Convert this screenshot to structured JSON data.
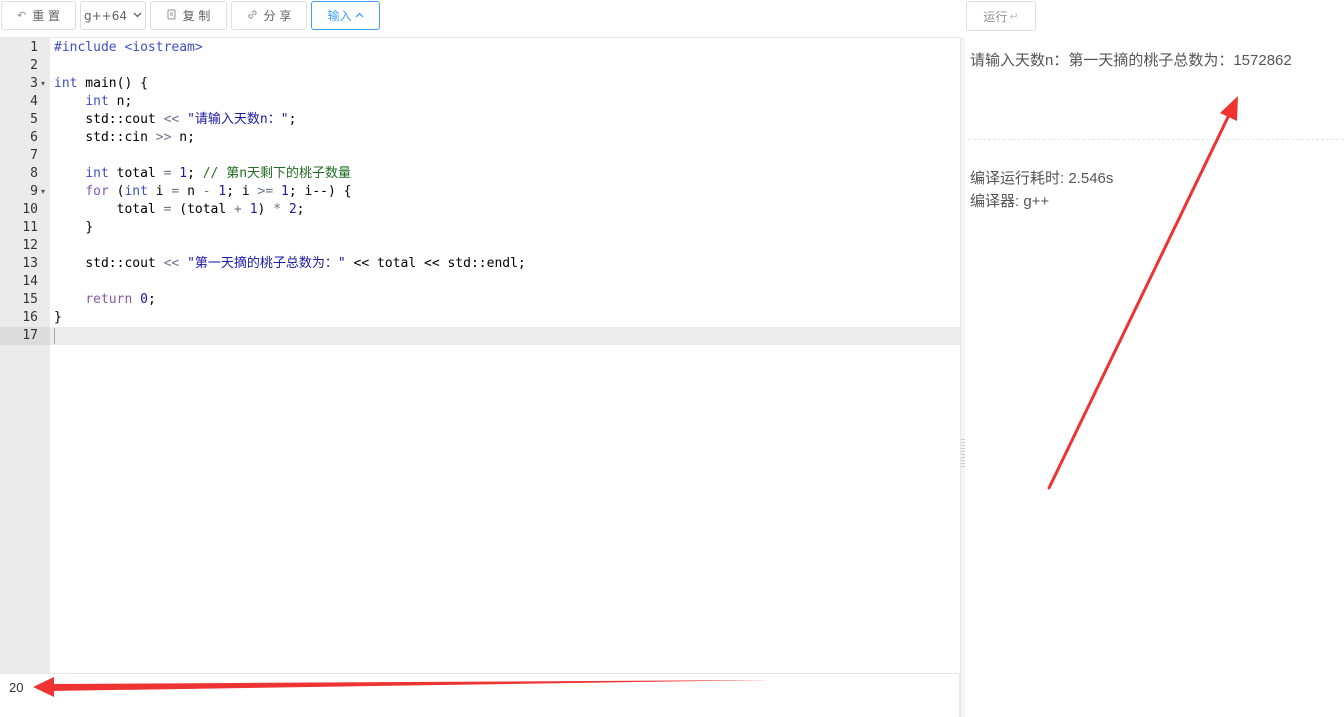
{
  "toolbar": {
    "reset_label": "重 置",
    "compiler_label": "g++64",
    "copy_label": "复 制",
    "share_label": "分 享",
    "input_label": "输入",
    "run_label": "运行"
  },
  "editor": {
    "lines": [
      {
        "num": "1"
      },
      {
        "num": "2"
      },
      {
        "num": "3"
      },
      {
        "num": "4"
      },
      {
        "num": "5"
      },
      {
        "num": "6"
      },
      {
        "num": "7"
      },
      {
        "num": "8"
      },
      {
        "num": "9"
      },
      {
        "num": "10"
      },
      {
        "num": "11"
      },
      {
        "num": "12"
      },
      {
        "num": "13"
      },
      {
        "num": "14"
      },
      {
        "num": "15"
      },
      {
        "num": "16"
      },
      {
        "num": "17"
      }
    ],
    "code": {
      "l1": "#include <iostream>",
      "l3_kw": "int",
      "l3_rest": " main() {",
      "l4_kw": "int",
      "l4_rest": " n;",
      "l5_a": "std::cout ",
      "l5_op": "<<",
      "l5_str": " \"请输入天数n：\"",
      "l5_end": ";",
      "l6_a": "std::cin ",
      "l6_op": ">>",
      "l6_end": " n;",
      "l8_kw": "int",
      "l8_a": " total ",
      "l8_op": "=",
      "l8_num": " 1",
      "l8_end": "; ",
      "l8_com": "// 第n天剩下的桃子数量",
      "l9_kw": "for",
      "l9_a": " (",
      "l9_kw2": "int",
      "l9_b": " i ",
      "l9_op1": "=",
      "l9_c": " n ",
      "l9_op2": "-",
      "l9_num1": " 1",
      "l9_d": "; i ",
      "l9_op3": ">=",
      "l9_num2": " 1",
      "l9_e": "; i--) {",
      "l10_a": "total ",
      "l10_op1": "=",
      "l10_b": " (total ",
      "l10_op2": "+",
      "l10_num1": " 1",
      "l10_c": ") ",
      "l10_op3": "*",
      "l10_num2": " 2",
      "l10_end": ";",
      "l11": "}",
      "l13_a": "std::cout ",
      "l13_op1": "<<",
      "l13_str": " \"第一天摘的桃子总数为：\"",
      "l13_b": " << total << std::endl;",
      "l15_kw": "return",
      "l15_num": " 0",
      "l15_end": ";",
      "l16": "}"
    }
  },
  "stdin": {
    "value": "20"
  },
  "output": {
    "result": "请输入天数n：第一天摘的桃子总数为：1572862",
    "time_label": "编译运行耗时: 2.546s",
    "compiler_label": "编译器: g++"
  },
  "colors": {
    "accent": "#409eff",
    "annotation_arrow": "#ee3333"
  },
  "icons": {
    "reset": "undo-icon",
    "copy": "copy-icon",
    "share": "link-icon",
    "input_caret": "chevron-up-icon",
    "compiler_caret": "chevron-down-icon",
    "run_enter": "enter-icon"
  }
}
